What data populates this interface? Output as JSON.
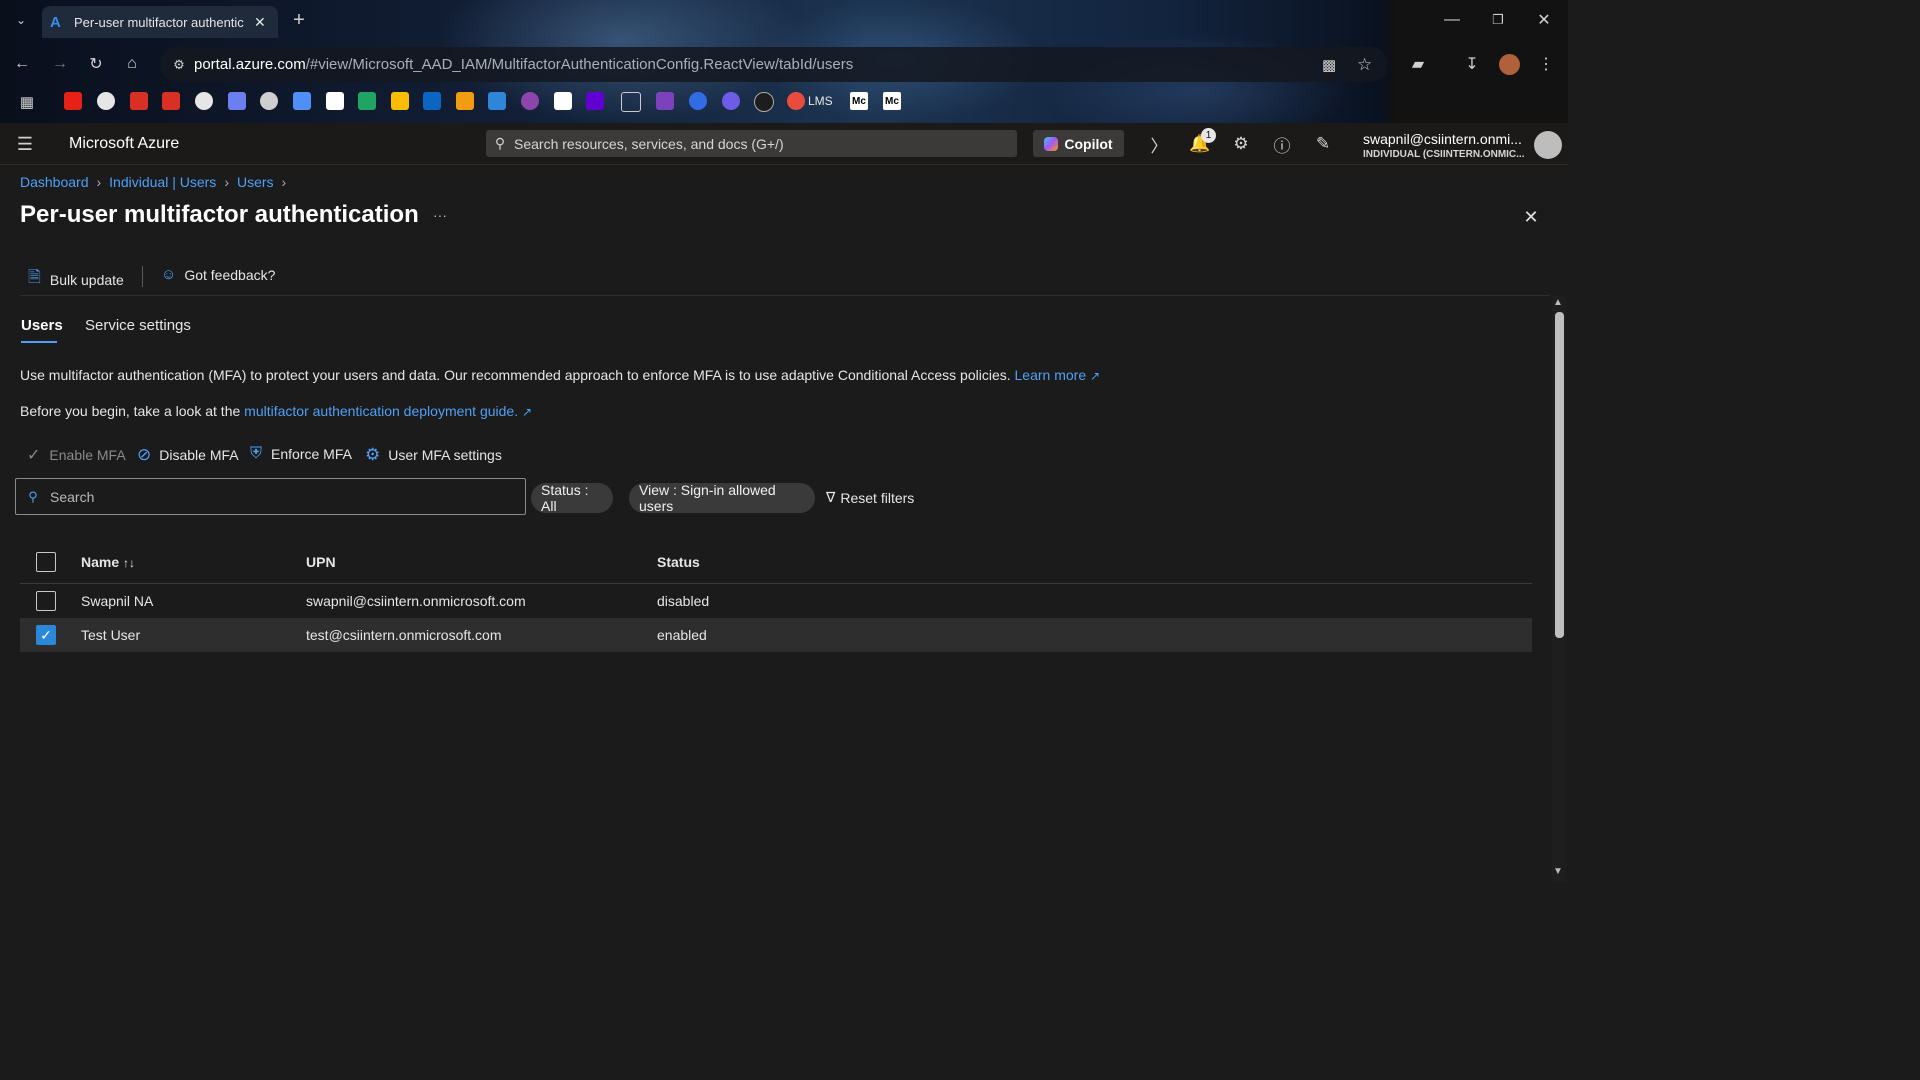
{
  "browser": {
    "tab_title": "Per-user multifactor authenticat",
    "tab_favicon": "azure-icon",
    "url_host": "portal.azure.com",
    "url_path": "/#view/Microsoft_AAD_IAM/MultifactorAuthenticationConfig.ReactView/tabId/users",
    "bookmarks": [
      "youtube",
      "github",
      "gmail",
      "gmail",
      "openai",
      "icon",
      "icon",
      "gemini",
      "gmail",
      "drive",
      "keep",
      "linkedin",
      "icon",
      "azure",
      "icon",
      "icon",
      "yahoo",
      "folder",
      "icon",
      "kubernetes",
      "icon",
      "icon",
      "icon",
      "Medium",
      "Medium"
    ],
    "bookmark_lms_label": "LMS",
    "bookmark_m1_label": "Mc",
    "bookmark_m2_label": "Mc"
  },
  "header": {
    "brand": "Microsoft Azure",
    "search_placeholder": "Search resources, services, and docs (G+/)",
    "copilot_label": "Copilot",
    "notification_count": "1",
    "account_email": "swapnil@csiintern.onmi...",
    "account_tenant": "INDIVIDUAL (CSIINTERN.ONMIC..."
  },
  "breadcrumb": {
    "items": [
      "Dashboard",
      "Individual | Users",
      "Users"
    ]
  },
  "page": {
    "title": "Per-user multifactor authentication",
    "more": "···"
  },
  "toolbar": {
    "bulk_update": "Bulk update",
    "feedback": "Got feedback?"
  },
  "tabs": {
    "users": "Users",
    "service_settings": "Service settings"
  },
  "info": {
    "line1": "Use multifactor authentication (MFA) to protect your users and data. Our recommended approach to enforce MFA is to use adaptive Conditional Access policies.",
    "learn_more": "Learn more",
    "line2_prefix": "Before you begin, take a look at the",
    "guide_link": "multifactor authentication deployment guide."
  },
  "actions": {
    "enable_mfa": "Enable MFA",
    "disable_mfa": "Disable MFA",
    "enforce_mfa": "Enforce MFA",
    "user_mfa_settings": "User MFA settings"
  },
  "filters": {
    "search_placeholder": "Search",
    "status_chip": "Status : All",
    "view_chip": "View : Sign-in allowed users",
    "reset": "Reset filters"
  },
  "table": {
    "columns": [
      "Name",
      "UPN",
      "Status"
    ],
    "sort_glyph": "↑↓",
    "rows": [
      {
        "name": "Swapnil NA",
        "upn": "swapnil@csiintern.onmicrosoft.com",
        "status": "disabled",
        "selected": false
      },
      {
        "name": "Test User",
        "upn": "test@csiintern.onmicrosoft.com",
        "status": "enabled",
        "selected": true
      }
    ]
  },
  "colors": {
    "accent": "#2b88d8",
    "link": "#4ea0f5",
    "background": "#1b1b1b",
    "selected_row": "#2e2e2e"
  }
}
